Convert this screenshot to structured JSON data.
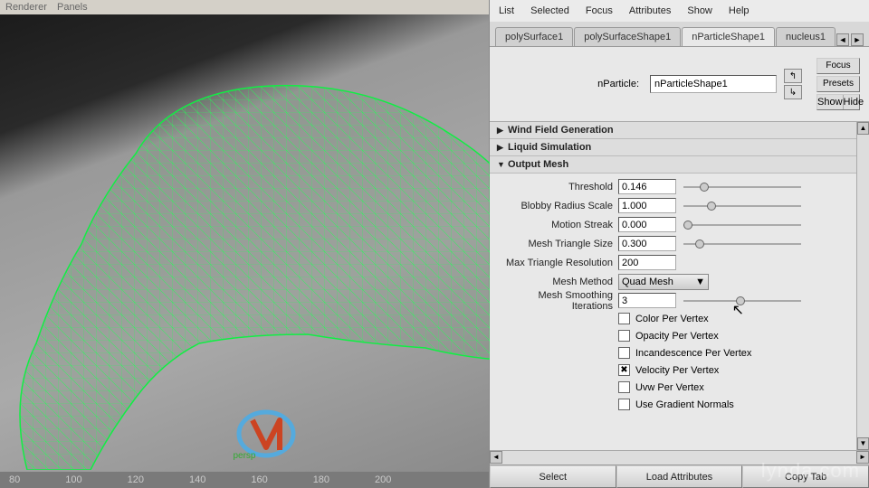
{
  "viewport": {
    "top_menu_1": "Renderer",
    "top_menu_2": "Panels",
    "camera": "persp",
    "ruler": [
      "80",
      "100",
      "120",
      "140",
      "160",
      "180",
      "200"
    ]
  },
  "menubar": [
    "List",
    "Selected",
    "Focus",
    "Attributes",
    "Show",
    "Help"
  ],
  "tabs": {
    "items": [
      "polySurface1",
      "polySurfaceShape1",
      "nParticleShape1",
      "nucleus1"
    ],
    "active": 2
  },
  "node": {
    "label": "nParticle:",
    "value": "nParticleShape1"
  },
  "side_buttons": {
    "focus": "Focus",
    "presets": "Presets",
    "show": "Show",
    "hide": "Hide"
  },
  "sections": {
    "wind": "Wind Field Generation",
    "liquid": "Liquid Simulation",
    "output": "Output Mesh"
  },
  "attrs": {
    "threshold": {
      "label": "Threshold",
      "value": "0.146",
      "pos": 14
    },
    "blobby": {
      "label": "Blobby Radius Scale",
      "value": "1.000",
      "pos": 20
    },
    "motion": {
      "label": "Motion Streak",
      "value": "0.000",
      "pos": 0
    },
    "triSize": {
      "label": "Mesh Triangle Size",
      "value": "0.300",
      "pos": 10
    },
    "maxRes": {
      "label": "Max Triangle Resolution",
      "value": "200"
    },
    "method": {
      "label": "Mesh Method",
      "value": "Quad Mesh"
    },
    "smooth": {
      "label": "Mesh Smoothing Iterations",
      "value": "3",
      "pos": 45
    }
  },
  "checks": {
    "color": {
      "label": "Color Per Vertex",
      "checked": false
    },
    "opacity": {
      "label": "Opacity Per Vertex",
      "checked": false
    },
    "incan": {
      "label": "Incandescence Per Vertex",
      "checked": false
    },
    "velocity": {
      "label": "Velocity Per Vertex",
      "checked": true
    },
    "uvw": {
      "label": "Uvw Per Vertex",
      "checked": false
    },
    "gradient": {
      "label": "Use Gradient Normals",
      "checked": false
    }
  },
  "bottom": {
    "select": "Select",
    "load": "Load Attributes",
    "copy": "Copy Tab"
  },
  "watermark": "lynda.com"
}
